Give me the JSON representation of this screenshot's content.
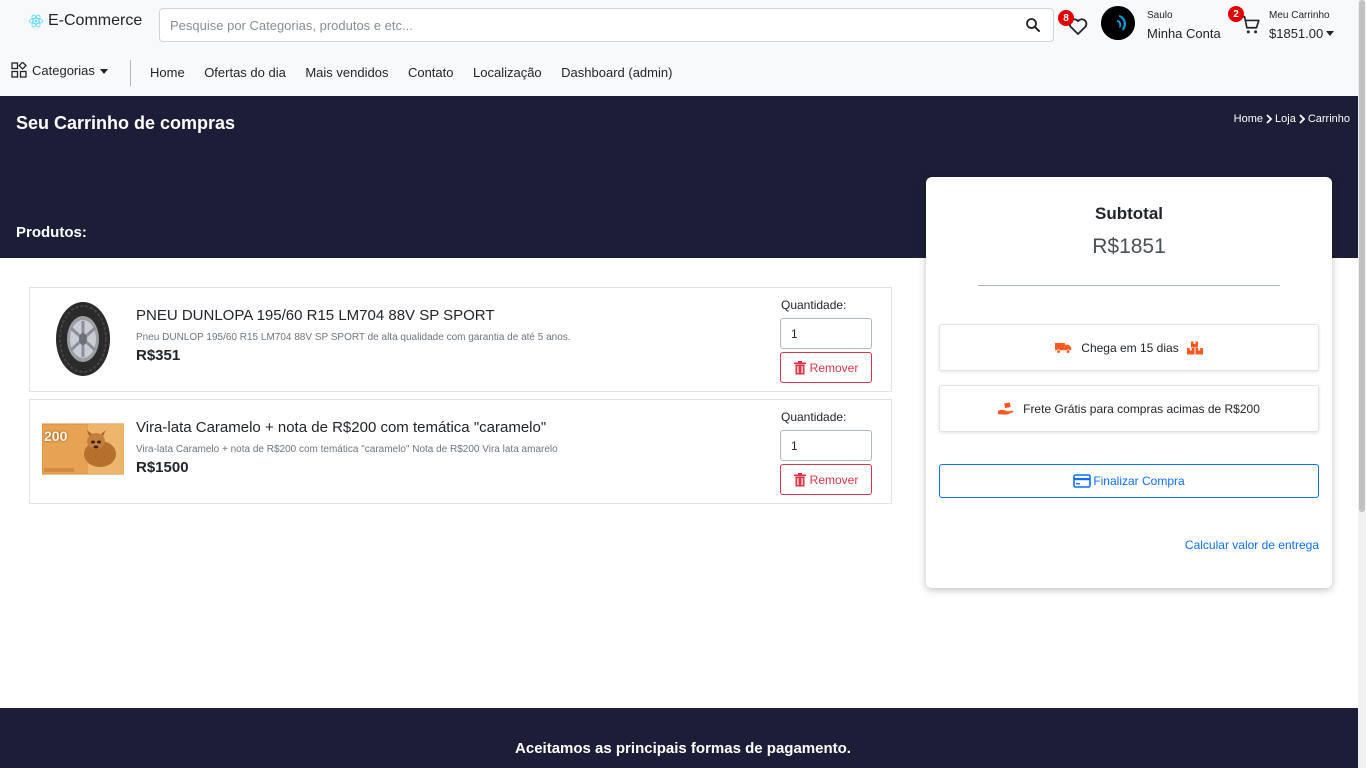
{
  "header": {
    "brand": "E-Commerce",
    "search_placeholder": "Pesquise por Categorias, produtos e etc...",
    "wishlist_count": "8",
    "account_greeting": "Saulo",
    "account_label": "Minha Conta",
    "cart_count": "2",
    "cart_label": "Meu Carrinho",
    "cart_total": "$1851.00"
  },
  "nav": {
    "categories": "Categorias",
    "links": [
      "Home",
      "Ofertas do dia",
      "Mais vendidos",
      "Contato",
      "Localização",
      "Dashboard (admin)"
    ]
  },
  "hero": {
    "title": "Seu Carrinho de compras",
    "breadcrumb": [
      "Home",
      "Loja",
      "Carrinho"
    ],
    "products_heading": "Produtos:"
  },
  "products": [
    {
      "name": "PNEU DUNLOPA 195/60 R15 LM704 88V SP SPORT",
      "description": "Pneu DUNLOP 195/60 R15 LM704 88V SP SPORT de alta qualidade com garantia de até 5 anos.",
      "price": "R$351",
      "quantity_label": "Quantidade:",
      "quantity": "1",
      "remove_label": "Remover",
      "image_icon": "tire-image"
    },
    {
      "name": "Vira-lata Caramelo + nota de R$200 com temática \"caramelo\"",
      "description": "Vira-lata Caramelo + nota de R$200 com temática \"caramelo\" Nota de R$200 Vira lata amarelo",
      "price": "R$1500",
      "quantity_label": "Quantidade:",
      "quantity": "1",
      "remove_label": "Remover",
      "image_icon": "banknote-image",
      "image_text": "200"
    }
  ],
  "summary": {
    "title": "Subtotal",
    "value": "R$1851",
    "delivery": "Chega em 15 dias",
    "free_shipping": "Frete Grátis para compras acimas de R$200",
    "checkout": "Finalizar Compra",
    "calculate": "Calcular valor de entrega"
  },
  "footer": {
    "text": "Aceitamos as principais formas de pagamento."
  },
  "colors": {
    "dark_bg": "#1c1e37",
    "accent_blue": "#0d6efd",
    "danger": "#dc3545",
    "badge_red": "#e00000",
    "shipping_orange": "#ff5722"
  }
}
